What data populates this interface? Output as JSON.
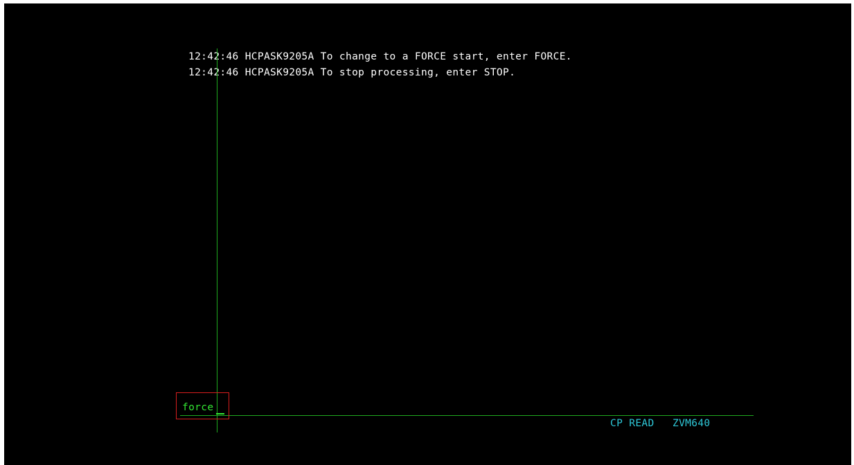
{
  "terminal": {
    "messages": [
      "12:42:46 HCPASK9205A To change to a FORCE start, enter FORCE.",
      "12:42:46 HCPASK9205A To stop processing, enter STOP."
    ],
    "input": {
      "value": "force"
    },
    "status": {
      "mode": "CP READ",
      "system": "ZVM640"
    },
    "colors": {
      "background": "#000000",
      "message_text": "#ffffff",
      "input_text": "#33e633",
      "status_text": "#2ec8d8",
      "crosshair": "#1faa1f",
      "input_highlight": "#d81e1e"
    }
  }
}
